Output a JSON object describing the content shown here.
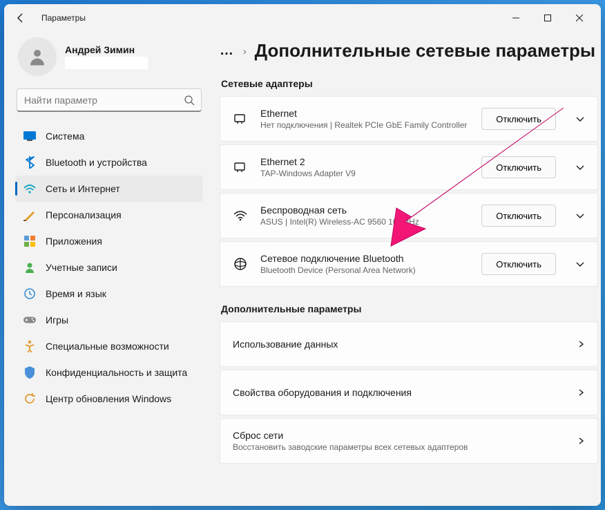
{
  "app": {
    "title": "Параметры"
  },
  "user": {
    "name": "Андрей Зимин"
  },
  "search": {
    "placeholder": "Найти параметр"
  },
  "nav": [
    {
      "label": "Система",
      "icon": "system"
    },
    {
      "label": "Bluetooth и устройства",
      "icon": "bluetooth"
    },
    {
      "label": "Сеть и Интернет",
      "icon": "network",
      "selected": true
    },
    {
      "label": "Персонализация",
      "icon": "personalize"
    },
    {
      "label": "Приложения",
      "icon": "apps"
    },
    {
      "label": "Учетные записи",
      "icon": "accounts"
    },
    {
      "label": "Время и язык",
      "icon": "time"
    },
    {
      "label": "Игры",
      "icon": "gaming"
    },
    {
      "label": "Специальные возможности",
      "icon": "accessibility"
    },
    {
      "label": "Конфиденциальность и защита",
      "icon": "privacy"
    },
    {
      "label": "Центр обновления Windows",
      "icon": "update"
    }
  ],
  "breadcrumb": {
    "ellipsis": "…",
    "title": "Дополнительные сетевые параметры"
  },
  "sections": {
    "adapters": {
      "header": "Сетевые адаптеры",
      "items": [
        {
          "title": "Ethernet",
          "sub": "Нет подключения | Realtek PCIe GbE Family Controller",
          "button": "Отключить",
          "icon": "ethernet"
        },
        {
          "title": "Ethernet 2",
          "sub": "TAP-Windows Adapter V9",
          "button": "Отключить",
          "icon": "ethernet"
        },
        {
          "title": "Беспроводная сеть",
          "sub": "ASUS | Intel(R) Wireless-AC 9560 160MHz",
          "button": "Отключить",
          "icon": "wifi"
        },
        {
          "title": "Сетевое подключение Bluetooth",
          "sub": "Bluetooth Device (Personal Area Network)",
          "button": "Отключить",
          "icon": "btnet"
        }
      ]
    },
    "more": {
      "header": "Дополнительные параметры",
      "items": [
        {
          "title": "Использование данных",
          "sub": ""
        },
        {
          "title": "Свойства оборудования и подключения",
          "sub": ""
        },
        {
          "title": "Сброс сети",
          "sub": "Восстановить заводские параметры всех сетевых адаптеров"
        }
      ]
    }
  }
}
